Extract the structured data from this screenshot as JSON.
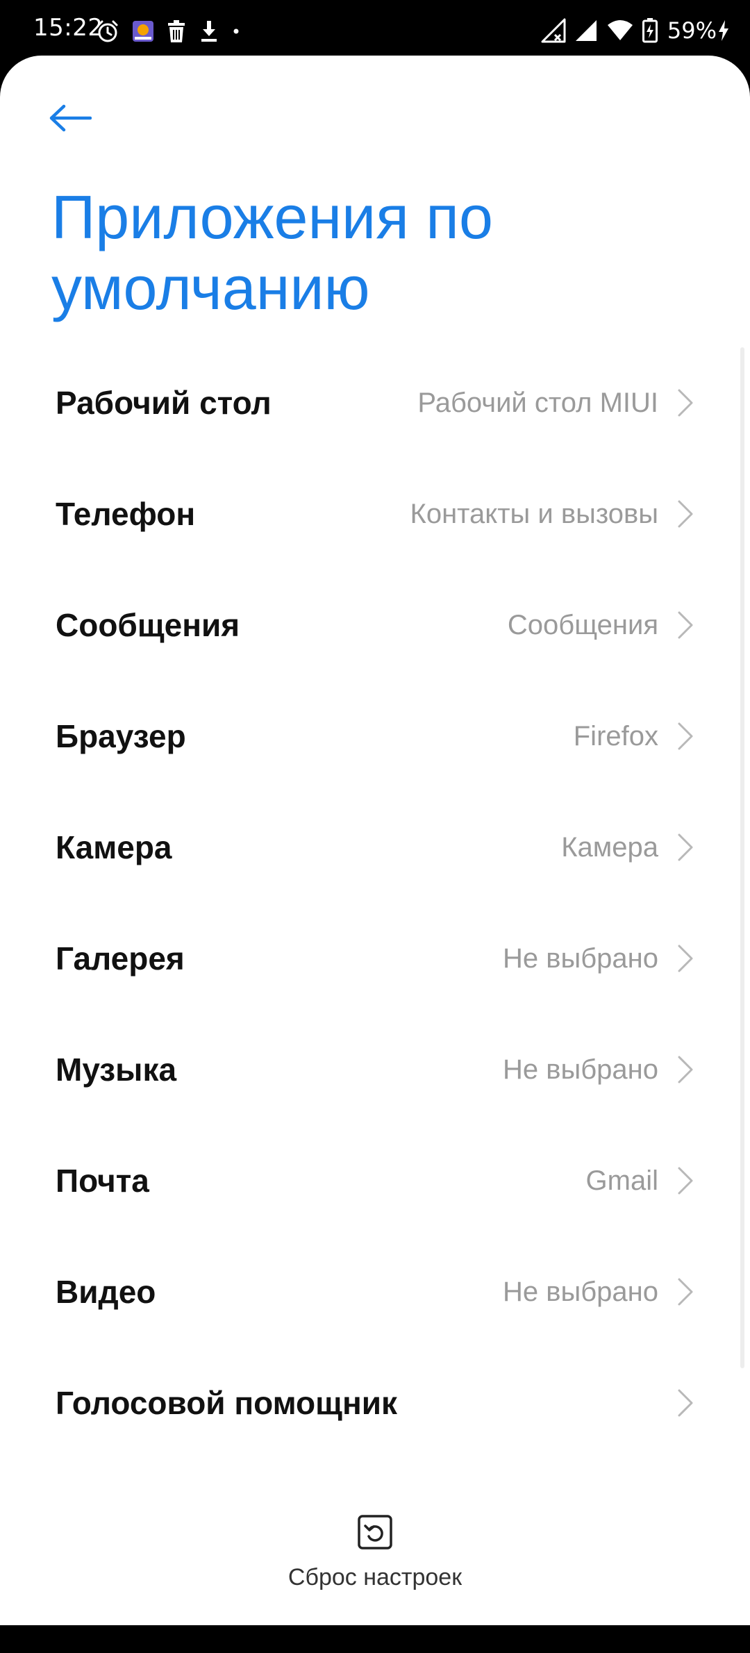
{
  "status_bar": {
    "time": "15:22",
    "battery": "59%",
    "left_icons": [
      "alarm-icon",
      "app-notification-icon",
      "trash-icon",
      "download-icon",
      "dot-icon"
    ],
    "right_icons": [
      "signal-no-data-icon",
      "signal-icon",
      "wifi-icon",
      "battery-charging-icon",
      "charging-bolt-icon"
    ]
  },
  "header": {
    "back_icon": "arrow-left-icon",
    "title": "Приложения по умолчанию"
  },
  "defaults": [
    {
      "label": "Рабочий стол",
      "value": "Рабочий стол MIUI"
    },
    {
      "label": "Телефон",
      "value": "Контакты и вызовы"
    },
    {
      "label": "Сообщения",
      "value": "Сообщения"
    },
    {
      "label": "Браузер",
      "value": "Firefox"
    },
    {
      "label": "Камера",
      "value": "Камера"
    },
    {
      "label": "Галерея",
      "value": "Не выбрано"
    },
    {
      "label": "Музыка",
      "value": "Не выбрано"
    },
    {
      "label": "Почта",
      "value": "Gmail"
    },
    {
      "label": "Видео",
      "value": "Не выбрано"
    },
    {
      "label": "Голосовой помощник",
      "value": ""
    }
  ],
  "footer": {
    "reset_icon": "reset-icon",
    "reset_label": "Сброс настроек"
  },
  "colors": {
    "accent": "#1a7ee6",
    "label": "#111111",
    "value": "#9a9a9a",
    "background": "#ffffff",
    "status_bar": "#000000"
  }
}
